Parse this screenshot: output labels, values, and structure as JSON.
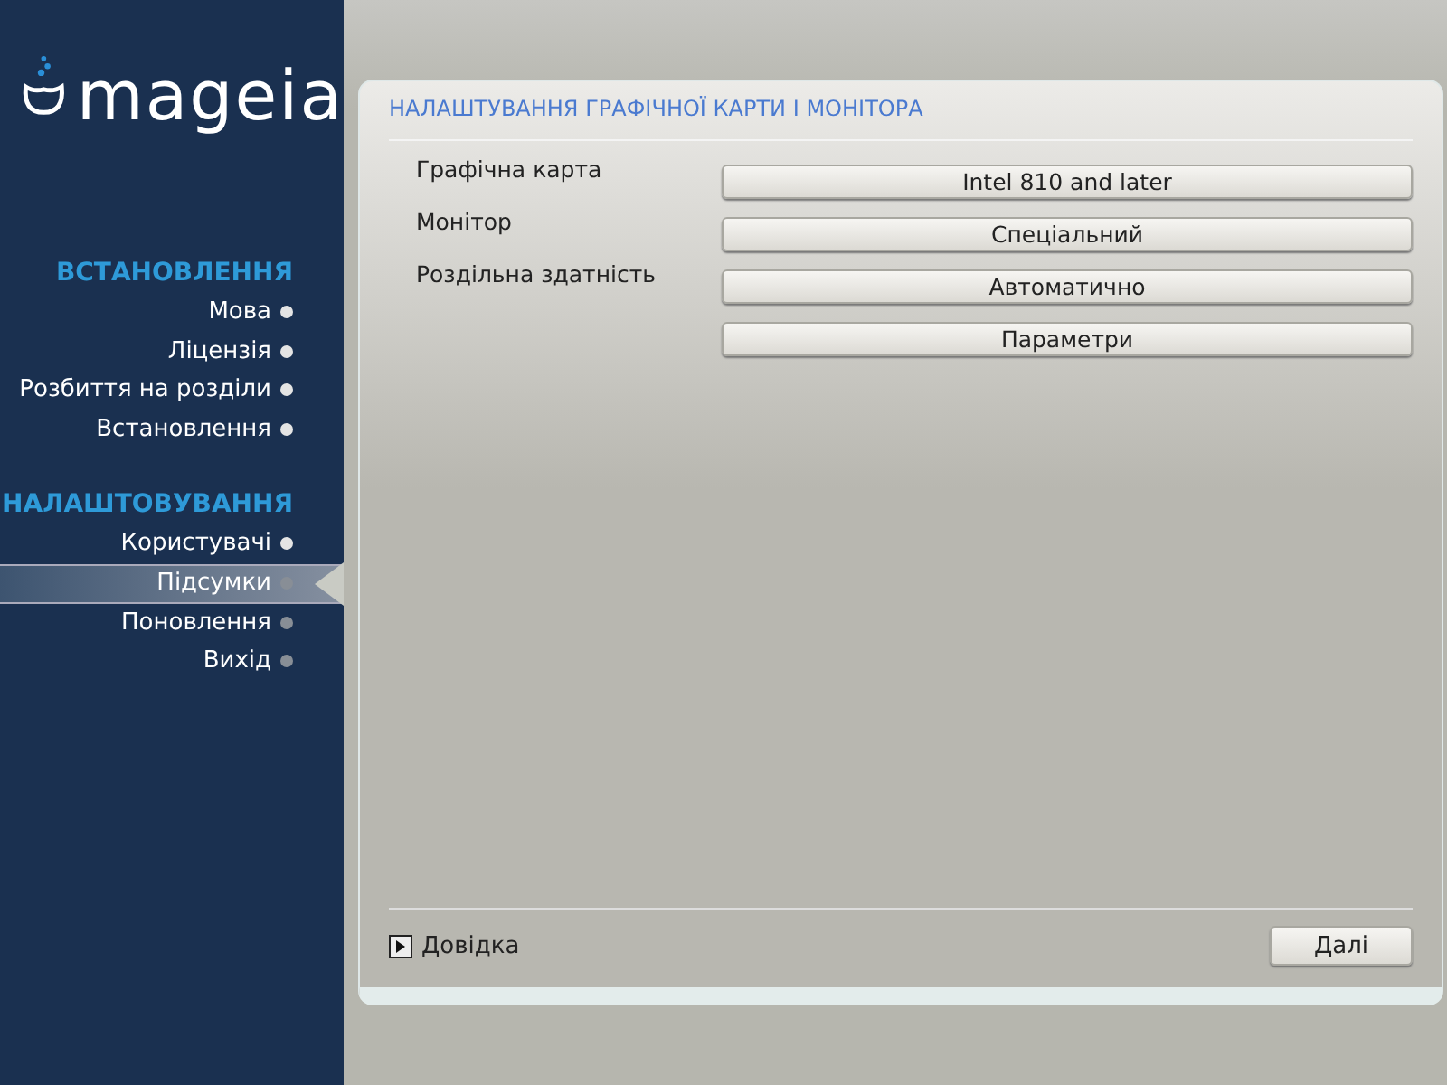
{
  "logo": "mageia",
  "sidebar": {
    "sections": [
      {
        "title": "ВСТАНОВЛЕННЯ",
        "items": [
          {
            "label": "Мова",
            "done": true,
            "selected": false
          },
          {
            "label": "Ліцензія",
            "done": true,
            "selected": false
          },
          {
            "label": "Розбиття на розділи",
            "done": true,
            "selected": false
          },
          {
            "label": "Встановлення",
            "done": true,
            "selected": false
          }
        ]
      },
      {
        "title": "НАЛАШТОВУВАННЯ",
        "items": [
          {
            "label": "Користувачі",
            "done": true,
            "selected": false
          },
          {
            "label": "Підсумки",
            "done": false,
            "selected": true
          },
          {
            "label": "Поновлення",
            "done": false,
            "selected": false
          },
          {
            "label": "Вихід",
            "done": false,
            "selected": false
          }
        ]
      }
    ]
  },
  "panel": {
    "title": "НАЛАШТУВАННЯ ГРАФІЧНОЇ КАРТИ І МОНІТОРА",
    "rows": [
      {
        "label": "Графічна карта",
        "button": "Intel 810 and later"
      },
      {
        "label": "Монітор",
        "button": "Спеціальний"
      },
      {
        "label": "Роздільна здатність",
        "button": "Автоматично"
      },
      {
        "button": "Параметри"
      }
    ],
    "help": {
      "label": "Довідка",
      "expanded": false
    },
    "next_button": "Далі"
  }
}
